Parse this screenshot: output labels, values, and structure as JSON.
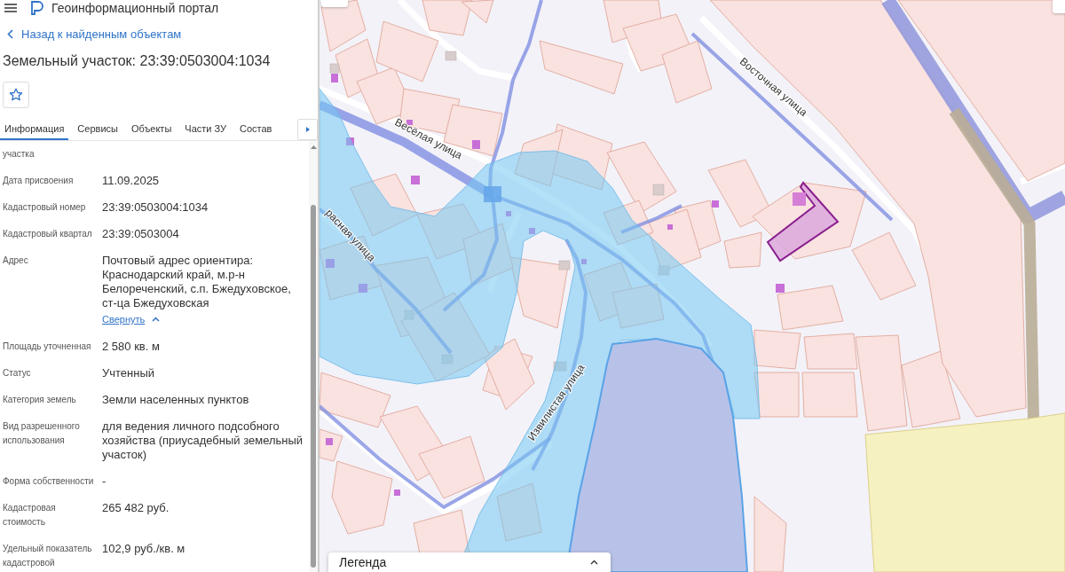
{
  "header": {
    "title": "Геоинформационный портал"
  },
  "back_link": {
    "label": "Назад к найденным объектам"
  },
  "object": {
    "title": "Земельный участок: 23:39:0503004:1034",
    "starred": false
  },
  "tabs": [
    {
      "label": "Информация",
      "selected": true
    },
    {
      "label": "Сервисы",
      "selected": false
    },
    {
      "label": "Объекты",
      "selected": false
    },
    {
      "label": "Части ЗУ",
      "selected": false
    },
    {
      "label": "Состав",
      "selected": false
    }
  ],
  "properties": [
    {
      "label": "участка"
    },
    {
      "label": "Дата присвоения",
      "value": "11.09.2025"
    },
    {
      "label": "Кадастровый номер",
      "value": "23:39:0503004:1034"
    },
    {
      "label": "Кадастровый квартал",
      "value": "23:39:0503004"
    },
    {
      "label": "Адрес",
      "value": "Почтовый адрес ориентира: Краснодарский край, м.р-н Белореченский, с.п. Бжедуховское, ст-ца Бжедуховская",
      "toggle_link": "Свернуть"
    },
    {
      "label": "Площадь уточненная",
      "value": "2 580 кв. м"
    },
    {
      "label": "Статус",
      "value": "Учтенный"
    },
    {
      "label": "Категория земель",
      "value": "Земли населенных пунктов"
    },
    {
      "label": "Вид разрешенного использования",
      "value": "для ведения личного подсобного хозяйства (приусадебный земельный участок)"
    },
    {
      "label": "Форма собственности",
      "value": "-"
    },
    {
      "label": "Кадастровая стоимость",
      "value": "265 482 руб."
    },
    {
      "label": "Удельный показатель кадастровой",
      "value": "102,9 руб./кв. м"
    }
  ],
  "map": {
    "street_labels": [
      "Весёлая улица",
      "Восточная улица",
      "расная улица",
      "Извилистая улица"
    ],
    "legend": {
      "title": "Легенда"
    }
  }
}
